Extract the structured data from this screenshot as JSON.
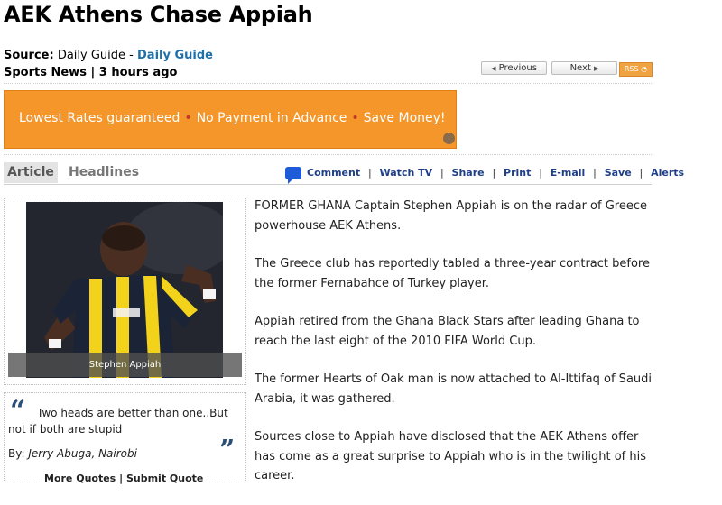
{
  "article": {
    "title": "AEK Athens Chase Appiah",
    "source_label": "Source:",
    "source_name": "Daily Guide",
    "source_separator": "-",
    "source_link": "Daily Guide",
    "category": "Sports News",
    "category_separator": "|",
    "time_ago": "3 hours ago",
    "paragraphs": [
      "FORMER GHANA Captain Stephen Appiah is on the radar of Greece powerhouse AEK Athens.",
      "The Greece club has reportedly tabled a three-year contract before the former Fernabahce of Turkey player.",
      "Appiah retired from the Ghana Black Stars after leading Ghana to reach the last eight of the 2010 FIFA World Cup.",
      "The former Hearts of Oak man is now attached to Al-Ittifaq of Saudi Arabia, it was gathered.",
      "Sources close to Appiah have disclosed that the AEK Athens offer has come as a great surprise to Appiah who is in the twilight of his career."
    ]
  },
  "nav": {
    "previous_label": "Previous",
    "next_label": "Next",
    "rss_label": "RSS"
  },
  "ad": {
    "items": [
      "Lowest Rates guaranteed",
      "No Payment in Advance",
      "Save Money!"
    ],
    "info_icon": "i"
  },
  "tabs": {
    "article_label": "Article",
    "headlines_label": "Headlines"
  },
  "tools": {
    "comment": "Comment",
    "watch_tv": "Watch TV",
    "share": "Share",
    "print": "Print",
    "email": "E-mail",
    "save": "Save",
    "alerts": "Alerts",
    "separator": "|"
  },
  "photo": {
    "caption": "Stephen Appiah",
    "colors": {
      "shirt_yellow": "#f2d21b",
      "shirt_navy": "#1b2436",
      "skin": "#4a2e22"
    }
  },
  "quote": {
    "open_mark": "“",
    "close_mark": "”",
    "text": "Two heads are better than one..But not if both are stupid",
    "author_label": "By:",
    "author": "Jerry Abuga, Nairobi",
    "more_quotes": "More Quotes",
    "link_separator": "|",
    "submit_quote": "Submit Quote"
  }
}
